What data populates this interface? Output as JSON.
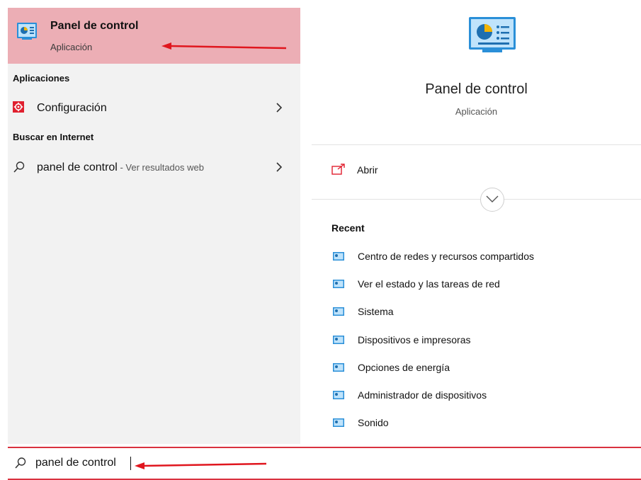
{
  "best_match": {
    "title": "Panel de control",
    "subtitle": "Aplicación",
    "icon": "control-panel-icon"
  },
  "sections": {
    "apps_header": "Aplicaciones",
    "web_header": "Buscar en Internet"
  },
  "apps": [
    {
      "label": "Configuración",
      "icon": "settings-gear-icon"
    }
  ],
  "web": [
    {
      "label": "panel de control",
      "hint": " - Ver resultados web",
      "icon": "search-icon"
    }
  ],
  "preview": {
    "title": "Panel de control",
    "subtitle": "Aplicación",
    "open_label": "Abrir",
    "recent_header": "Recent",
    "recent_items": [
      "Centro de redes y recursos compartidos",
      "Ver el estado y las tareas de red",
      "Sistema",
      "Dispositivos e impresoras",
      "Opciones de energía",
      "Administrador de dispositivos",
      "Sonido"
    ]
  },
  "search": {
    "value": "panel de control"
  },
  "colors": {
    "highlight": "#ecaeb5",
    "accent_red": "#d9323f",
    "panel_bg": "#f2f2f2"
  }
}
